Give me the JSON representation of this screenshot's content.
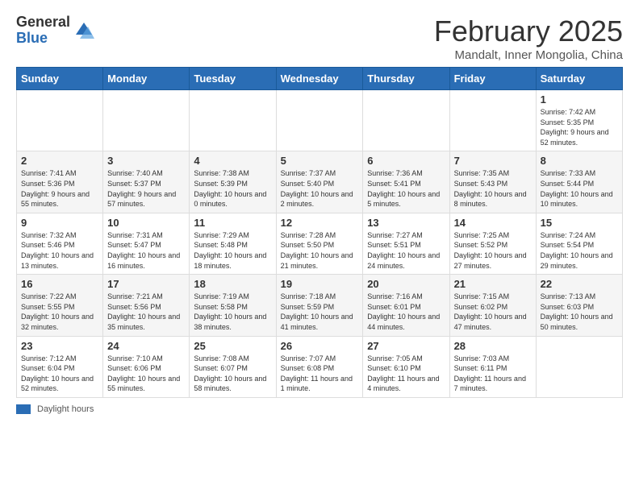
{
  "header": {
    "logo_general": "General",
    "logo_blue": "Blue",
    "title": "February 2025",
    "subtitle": "Mandalt, Inner Mongolia, China"
  },
  "footer": {
    "daylight_label": "Daylight hours"
  },
  "weekdays": [
    "Sunday",
    "Monday",
    "Tuesday",
    "Wednesday",
    "Thursday",
    "Friday",
    "Saturday"
  ],
  "weeks": [
    [
      {
        "day": "",
        "info": ""
      },
      {
        "day": "",
        "info": ""
      },
      {
        "day": "",
        "info": ""
      },
      {
        "day": "",
        "info": ""
      },
      {
        "day": "",
        "info": ""
      },
      {
        "day": "",
        "info": ""
      },
      {
        "day": "1",
        "info": "Sunrise: 7:42 AM\nSunset: 5:35 PM\nDaylight: 9 hours and 52 minutes."
      }
    ],
    [
      {
        "day": "2",
        "info": "Sunrise: 7:41 AM\nSunset: 5:36 PM\nDaylight: 9 hours and 55 minutes."
      },
      {
        "day": "3",
        "info": "Sunrise: 7:40 AM\nSunset: 5:37 PM\nDaylight: 9 hours and 57 minutes."
      },
      {
        "day": "4",
        "info": "Sunrise: 7:38 AM\nSunset: 5:39 PM\nDaylight: 10 hours and 0 minutes."
      },
      {
        "day": "5",
        "info": "Sunrise: 7:37 AM\nSunset: 5:40 PM\nDaylight: 10 hours and 2 minutes."
      },
      {
        "day": "6",
        "info": "Sunrise: 7:36 AM\nSunset: 5:41 PM\nDaylight: 10 hours and 5 minutes."
      },
      {
        "day": "7",
        "info": "Sunrise: 7:35 AM\nSunset: 5:43 PM\nDaylight: 10 hours and 8 minutes."
      },
      {
        "day": "8",
        "info": "Sunrise: 7:33 AM\nSunset: 5:44 PM\nDaylight: 10 hours and 10 minutes."
      }
    ],
    [
      {
        "day": "9",
        "info": "Sunrise: 7:32 AM\nSunset: 5:46 PM\nDaylight: 10 hours and 13 minutes."
      },
      {
        "day": "10",
        "info": "Sunrise: 7:31 AM\nSunset: 5:47 PM\nDaylight: 10 hours and 16 minutes."
      },
      {
        "day": "11",
        "info": "Sunrise: 7:29 AM\nSunset: 5:48 PM\nDaylight: 10 hours and 18 minutes."
      },
      {
        "day": "12",
        "info": "Sunrise: 7:28 AM\nSunset: 5:50 PM\nDaylight: 10 hours and 21 minutes."
      },
      {
        "day": "13",
        "info": "Sunrise: 7:27 AM\nSunset: 5:51 PM\nDaylight: 10 hours and 24 minutes."
      },
      {
        "day": "14",
        "info": "Sunrise: 7:25 AM\nSunset: 5:52 PM\nDaylight: 10 hours and 27 minutes."
      },
      {
        "day": "15",
        "info": "Sunrise: 7:24 AM\nSunset: 5:54 PM\nDaylight: 10 hours and 29 minutes."
      }
    ],
    [
      {
        "day": "16",
        "info": "Sunrise: 7:22 AM\nSunset: 5:55 PM\nDaylight: 10 hours and 32 minutes."
      },
      {
        "day": "17",
        "info": "Sunrise: 7:21 AM\nSunset: 5:56 PM\nDaylight: 10 hours and 35 minutes."
      },
      {
        "day": "18",
        "info": "Sunrise: 7:19 AM\nSunset: 5:58 PM\nDaylight: 10 hours and 38 minutes."
      },
      {
        "day": "19",
        "info": "Sunrise: 7:18 AM\nSunset: 5:59 PM\nDaylight: 10 hours and 41 minutes."
      },
      {
        "day": "20",
        "info": "Sunrise: 7:16 AM\nSunset: 6:01 PM\nDaylight: 10 hours and 44 minutes."
      },
      {
        "day": "21",
        "info": "Sunrise: 7:15 AM\nSunset: 6:02 PM\nDaylight: 10 hours and 47 minutes."
      },
      {
        "day": "22",
        "info": "Sunrise: 7:13 AM\nSunset: 6:03 PM\nDaylight: 10 hours and 50 minutes."
      }
    ],
    [
      {
        "day": "23",
        "info": "Sunrise: 7:12 AM\nSunset: 6:04 PM\nDaylight: 10 hours and 52 minutes."
      },
      {
        "day": "24",
        "info": "Sunrise: 7:10 AM\nSunset: 6:06 PM\nDaylight: 10 hours and 55 minutes."
      },
      {
        "day": "25",
        "info": "Sunrise: 7:08 AM\nSunset: 6:07 PM\nDaylight: 10 hours and 58 minutes."
      },
      {
        "day": "26",
        "info": "Sunrise: 7:07 AM\nSunset: 6:08 PM\nDaylight: 11 hours and 1 minute."
      },
      {
        "day": "27",
        "info": "Sunrise: 7:05 AM\nSunset: 6:10 PM\nDaylight: 11 hours and 4 minutes."
      },
      {
        "day": "28",
        "info": "Sunrise: 7:03 AM\nSunset: 6:11 PM\nDaylight: 11 hours and 7 minutes."
      },
      {
        "day": "",
        "info": ""
      }
    ]
  ]
}
